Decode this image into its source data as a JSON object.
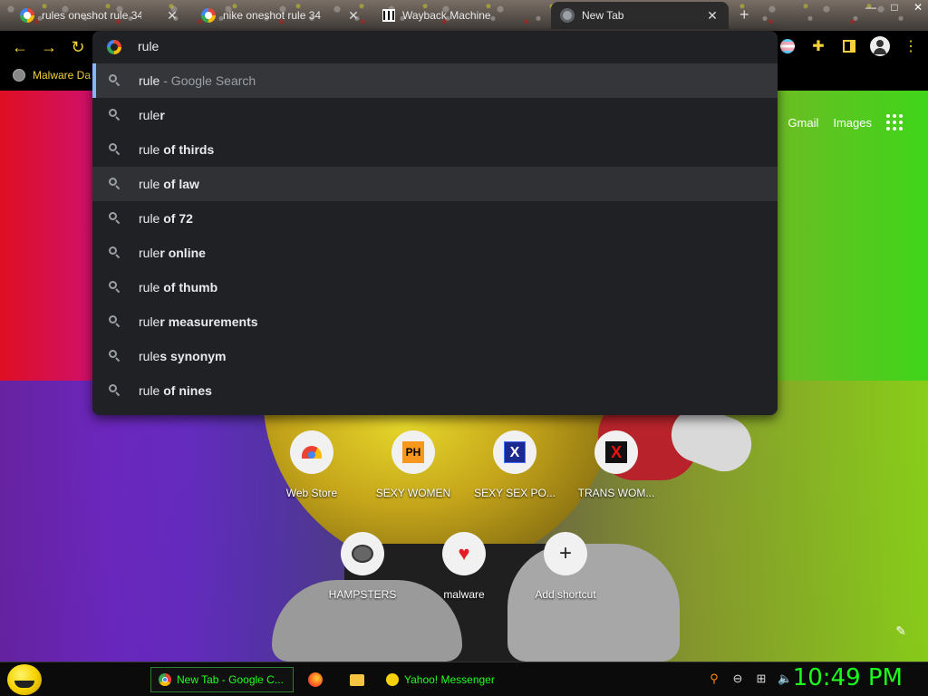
{
  "tabs": [
    {
      "label": "rules oneshot rule 34 -",
      "favicon": "google-icon"
    },
    {
      "label": "nike oneshot rule 34 - C",
      "favicon": "google-icon"
    },
    {
      "label": "Wayback Machine",
      "favicon": "wayback-icon"
    },
    {
      "label": "New Tab",
      "favicon": "chrome-icon",
      "active": true
    }
  ],
  "tab_close_symbol": "✕",
  "new_tab_symbol": "+",
  "window_controls": {
    "minimize": "—",
    "maximize": "□",
    "close": "✕"
  },
  "toolbar": {
    "back": "←",
    "forward": "→",
    "reload": "↻"
  },
  "bookmarks": [
    {
      "label": "Malware Da"
    }
  ],
  "omnibox": {
    "value": "rule",
    "suggestions": [
      {
        "typed": "rule",
        "completion": "",
        "desc": " - Google Search",
        "selected": true
      },
      {
        "typed": "rule",
        "completion": "r"
      },
      {
        "typed": "rule",
        "completion": " of thirds"
      },
      {
        "typed": "rule",
        "completion": " of law",
        "hover": true
      },
      {
        "typed": "rule",
        "completion": " of 72"
      },
      {
        "typed": "rule",
        "completion": "r online"
      },
      {
        "typed": "rule",
        "completion": " of thumb"
      },
      {
        "typed": "rule",
        "completion": "r measurements"
      },
      {
        "typed": "rule",
        "completion": "s synonym"
      },
      {
        "typed": "rule",
        "completion": " of nines"
      }
    ]
  },
  "ntp": {
    "gmail": "Gmail",
    "images": "Images",
    "shortcuts": [
      {
        "label": "Web Store",
        "icon": "webstore-icon"
      },
      {
        "label": "SEXY WOMEN",
        "icon": "ph-icon",
        "icon_text": "PH"
      },
      {
        "label": "SEXY SEX PO...",
        "icon": "x-icon",
        "icon_text": "X"
      },
      {
        "label": "TRANS WOM...",
        "icon": "x-red-icon",
        "icon_text": "X"
      },
      {
        "label": "HAMPSTERS",
        "icon": "hamster-icon"
      },
      {
        "label": "malware",
        "icon": "heart-icon",
        "icon_text": "♥"
      },
      {
        "label": "Add shortcut",
        "icon": "plus-icon",
        "icon_text": "+"
      }
    ],
    "edit_symbol": "✎"
  },
  "taskbar": {
    "tasks": [
      {
        "label": "New Tab - Google C...",
        "icon": "chrome-icon"
      },
      {
        "label": "Yahoo! Messenger",
        "icon": "yahoo-icon"
      }
    ],
    "clock": "10:49 PM"
  },
  "colors": {
    "accent_yellow": "#f4d13c",
    "omnibox_bg": "#202124",
    "clock_green": "#1cff1c"
  }
}
